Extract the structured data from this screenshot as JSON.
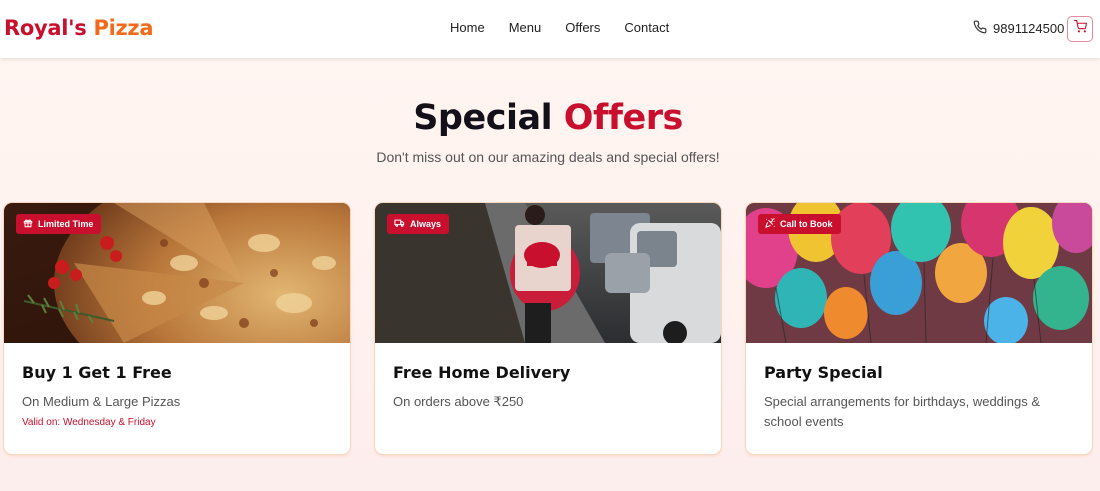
{
  "brand": {
    "name_part1": "Royal's",
    "name_part2": "Pizza",
    "color_primary": "#c8102e",
    "color_secondary": "#f26a1b"
  },
  "nav": {
    "items": [
      {
        "label": "Home"
      },
      {
        "label": "Menu"
      },
      {
        "label": "Offers"
      },
      {
        "label": "Contact"
      }
    ]
  },
  "contact": {
    "phone": "9891124500",
    "phone_icon": "phone-icon",
    "cart_icon": "cart-icon"
  },
  "hero": {
    "title_main": "Special",
    "title_accent": "Offers",
    "subtitle": "Don't miss out on our amazing deals and special offers!"
  },
  "offers": [
    {
      "badge": "Limited Time",
      "badge_icon": "gift-icon",
      "image": "pizza-image",
      "title": "Buy 1 Get 1 Free",
      "description": "On Medium & Large Pizzas",
      "valid": "Valid on: Wednesday & Friday"
    },
    {
      "badge": "Always",
      "badge_icon": "truck-icon",
      "image": "delivery-rider-image",
      "title": "Free Home Delivery",
      "description": "On orders above ₹250"
    },
    {
      "badge": "Call to Book",
      "badge_icon": "party-popper-icon",
      "image": "balloons-image",
      "title": "Party Special",
      "description": "Special arrangements for birthdays, weddings & school events"
    }
  ]
}
